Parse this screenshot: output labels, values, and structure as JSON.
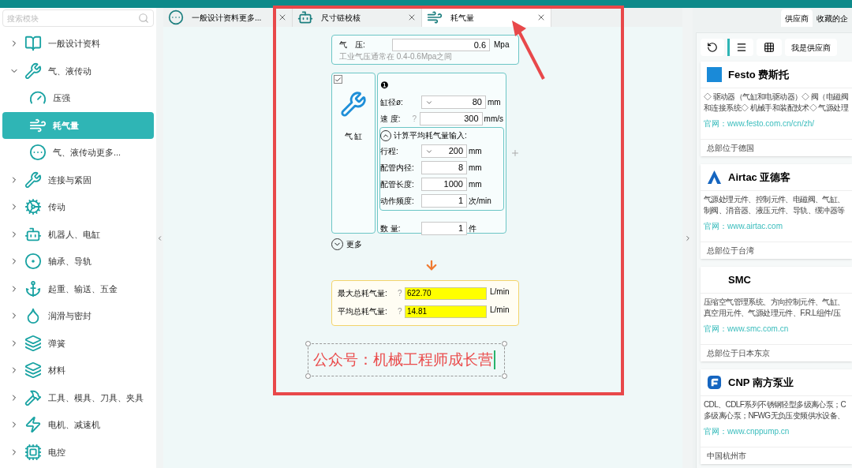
{
  "sidebar": {
    "search": {
      "placeholder": "搜索模块"
    },
    "items": [
      {
        "label": "一般设计资料",
        "expanded": false,
        "selected": false
      },
      {
        "label": "气、液传动",
        "expanded": true,
        "selected": false,
        "children": [
          {
            "label": "压强",
            "selected": false
          },
          {
            "label": "耗气量",
            "selected": true
          },
          {
            "label": "气、液传动更多...",
            "selected": false
          }
        ]
      },
      {
        "label": "连接与紧固",
        "expanded": false,
        "selected": false
      },
      {
        "label": "传动",
        "expanded": false,
        "selected": false
      },
      {
        "label": "机器人、电缸",
        "expanded": false,
        "selected": false
      },
      {
        "label": "轴承、导轨",
        "expanded": false,
        "selected": false
      },
      {
        "label": "起重、输送、五金",
        "expanded": false,
        "selected": false
      },
      {
        "label": "润滑与密封",
        "expanded": false,
        "selected": false
      },
      {
        "label": "弹簧",
        "expanded": false,
        "selected": false
      },
      {
        "label": "材料",
        "expanded": false,
        "selected": false
      },
      {
        "label": "工具、模具、刀具、夹具",
        "expanded": false,
        "selected": false
      },
      {
        "label": "电机、减速机",
        "expanded": false,
        "selected": false
      },
      {
        "label": "电控",
        "expanded": false,
        "selected": false
      }
    ]
  },
  "tabs": [
    {
      "label": "一般设计资料更多...",
      "selected": false
    },
    {
      "label": "尺寸链校核",
      "selected": false
    },
    {
      "label": "耗气量",
      "selected": true
    }
  ],
  "form": {
    "pressure": {
      "label": "气　压:",
      "value": "0.6",
      "unit": "Mpa",
      "hint": "工业气压通常在 0.4-0.6Mpa之间"
    },
    "cylinder": {
      "checked": true,
      "label": "气 缸",
      "number": "❶",
      "fields": [
        {
          "label": "缸径ø:",
          "value": "80",
          "unit": "mm",
          "dropdown": true
        },
        {
          "label": "速 度:",
          "help": "?",
          "value": "300",
          "unit": "mm/s",
          "dropdown": false
        }
      ],
      "average": {
        "title": "计算平均耗气量输入:",
        "expanded": true,
        "fields": [
          {
            "label": "行程:",
            "value": "200",
            "unit": "mm",
            "dropdown": true
          },
          {
            "label": "配管内径:",
            "value": "8",
            "unit": "mm",
            "dropdown": false
          },
          {
            "label": "配管长度:",
            "value": "1000",
            "unit": "mm",
            "dropdown": false
          },
          {
            "label": "动作频度:",
            "value": "1",
            "unit": "次/min",
            "dropdown": false
          }
        ]
      },
      "quantity": {
        "label": "数 量:",
        "value": "1",
        "unit": "件"
      }
    },
    "more": "更多",
    "results": [
      {
        "label": "最大总耗气量:",
        "help": "?",
        "value": "622.70",
        "unit": "L/min"
      },
      {
        "label": "平均总耗气量:",
        "help": "?",
        "value": "14.81",
        "unit": "L/min"
      }
    ]
  },
  "text_box": "公众号：机械工程师成长营",
  "suppliers": {
    "tabs": [
      {
        "label": "供应商",
        "selected": true
      },
      {
        "label": "收藏的企",
        "selected": false
      }
    ],
    "supplier_button": "我是供应商",
    "cards": [
      {
        "name": "Festo 费斯托",
        "description_lines": [
          "◇ 驱动器（气缸和电驱动器）◇ 阀（电磁阀",
          "和连接系统◇ 机械手和装配技术◇ 气源处理"
        ],
        "website": "官网：www.festo.com.cn/cn/zh/",
        "location": "总部位于德国"
      },
      {
        "name": "Airtac 亚德客",
        "description_lines": [
          "气源处理元件、控制元件、电磁阀、气缸、",
          "制阀、消音器、液压元件、导轨、缓冲器等"
        ],
        "website": "官网：www.airtac.com",
        "location": "总部位于台湾"
      },
      {
        "name": "SMC",
        "description_lines": [
          "压缩空气管理系统、方向控制元件、气缸、",
          "真空用元件、气源处理元件、F.R.L组件/压"
        ],
        "website": "官网：www.smc.com.cn",
        "location": "总部位于日本东京"
      },
      {
        "name": "CNP 南方泵业",
        "description_lines": [
          "CDL、CDLF系列不锈钢轻型多级离心泵；C",
          "多级离心泵；NFWG无负压变频供水设备、"
        ],
        "website": "官网：www.cnppump.cn",
        "location": "中国杭州市"
      }
    ]
  }
}
